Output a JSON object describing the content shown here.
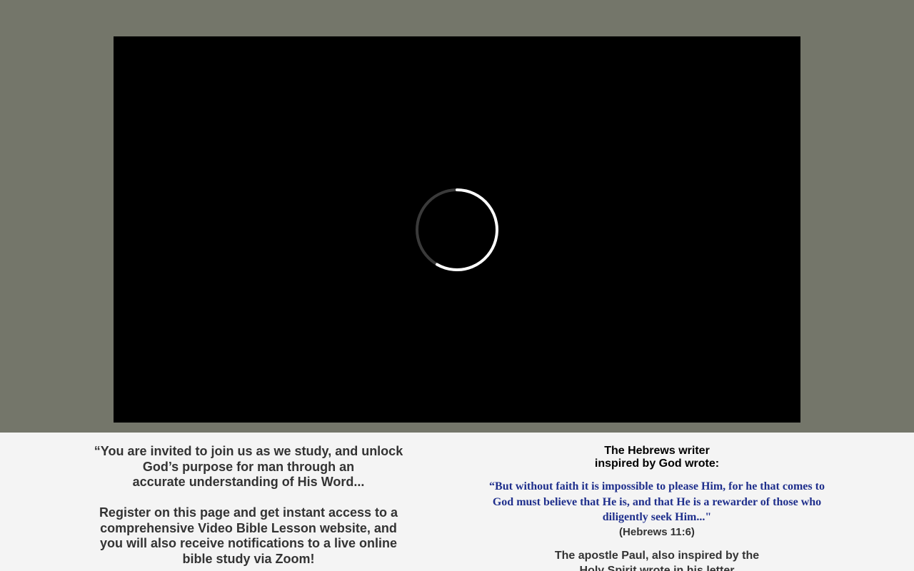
{
  "invitation": {
    "line1": "“You are invited to join us as we study, and unlock",
    "line2": "God’s purpose for man through an",
    "line3": "accurate understanding of His Word...",
    "line4": "Register on this page and get instant access to a",
    "line5": "comprehensive Video Bible Lesson website, and",
    "line6": "you will also receive notifications to a live online",
    "line7": "bible study via Zoom!"
  },
  "hebrews": {
    "heading_line1": "The Hebrews writer",
    "heading_line2": "inspired by God wrote:",
    "quote_line1": "“But without faith it is impossible to please Him, for he that comes to",
    "quote_line2": "God must believe that He is, and that He is a rewarder of those who",
    "quote_line3": "diligently seek Him...\"",
    "reference": "(Hebrews 11:6)"
  },
  "paul": {
    "line1": "The apostle Paul, also inspired by the",
    "line2": "Holy Spirit wrote in his letter"
  },
  "video": {
    "state": "loading",
    "spinner_icon": "loading-spinner-icon"
  },
  "colors": {
    "hero_bg": "#74766a",
    "content_bg": "#f4f4f4",
    "quote_text": "#1f2f8c",
    "body_text": "#333333"
  }
}
